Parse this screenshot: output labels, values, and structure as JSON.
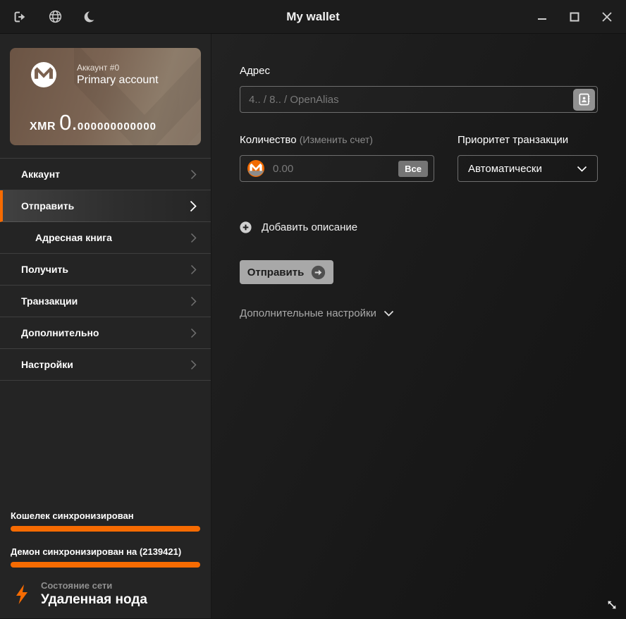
{
  "titlebar": {
    "title": "My wallet",
    "icons": [
      "logout",
      "globe",
      "moon"
    ],
    "window_controls": [
      "minimize",
      "maximize",
      "close"
    ]
  },
  "account_card": {
    "account_label": "Аккаунт #0",
    "account_name": "Primary account",
    "currency": "XMR",
    "balance_integer": "0.",
    "balance_fraction": "000000000000"
  },
  "sidebar": {
    "items": [
      {
        "label": "Аккаунт",
        "active": false,
        "sub": false
      },
      {
        "label": "Отправить",
        "active": true,
        "sub": false
      },
      {
        "label": "Адресная книга",
        "active": false,
        "sub": true
      },
      {
        "label": "Получить",
        "active": false,
        "sub": false
      },
      {
        "label": "Транзакции",
        "active": false,
        "sub": false
      },
      {
        "label": "Дополнительно",
        "active": false,
        "sub": false
      },
      {
        "label": "Настройки",
        "active": false,
        "sub": false
      }
    ]
  },
  "send_form": {
    "address_label": "Адрес",
    "address_placeholder": "4.. / 8.. / OpenAlias",
    "amount_label": "Количество",
    "amount_hint": "(Изменить счет)",
    "amount_placeholder": "0.00",
    "all_button": "Все",
    "priority_label": "Приоритет транзакции",
    "priority_value": "Автоматически",
    "add_description": "Добавить описание",
    "send_button": "Отправить",
    "advanced_settings": "Дополнительные настройки"
  },
  "status": {
    "wallet_sync_label": "Кошелек синхронизирован",
    "wallet_sync_progress": 100,
    "daemon_sync_label": "Демон синхронизирован на (2139421)",
    "daemon_sync_progress": 100,
    "daemon_height": "2139421",
    "network_label": "Состояние сети",
    "network_value": "Удаленная нода"
  },
  "colors": {
    "accent_orange": "#f66b02",
    "card_brown_start": "#6b5444",
    "card_brown_end": "#8d7c6a",
    "titlebar_bg": "#1c1c1c",
    "sidebar_bg": "#242424",
    "input_border": "#6e6e6e"
  }
}
